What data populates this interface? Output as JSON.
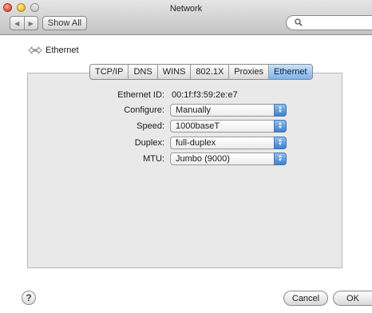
{
  "window": {
    "title": "Network"
  },
  "toolbar": {
    "back_glyph": "◀",
    "forward_glyph": "▶",
    "show_all_label": "Show All",
    "search_placeholder": ""
  },
  "header": {
    "label": "Ethernet",
    "icon": "ethernet-arrows-icon"
  },
  "tabs": [
    {
      "label": "TCP/IP",
      "active": false
    },
    {
      "label": "DNS",
      "active": false
    },
    {
      "label": "WINS",
      "active": false
    },
    {
      "label": "802.1X",
      "active": false
    },
    {
      "label": "Proxies",
      "active": false
    },
    {
      "label": "Ethernet",
      "active": true
    }
  ],
  "form": {
    "ethernet_id": {
      "label": "Ethernet ID:",
      "value": "00:1f:f3:59:2e:e7"
    },
    "configure": {
      "label": "Configure:",
      "value": "Manually"
    },
    "speed": {
      "label": "Speed:",
      "value": "1000baseT"
    },
    "duplex": {
      "label": "Duplex:",
      "value": "full-duplex"
    },
    "mtu": {
      "label": "MTU:",
      "value": "Jumbo  (9000)"
    }
  },
  "footer": {
    "help_label": "?",
    "cancel_label": "Cancel",
    "ok_label": "OK"
  },
  "colors": {
    "accent": "#7db3ea",
    "panel": "#e9e9e9"
  }
}
